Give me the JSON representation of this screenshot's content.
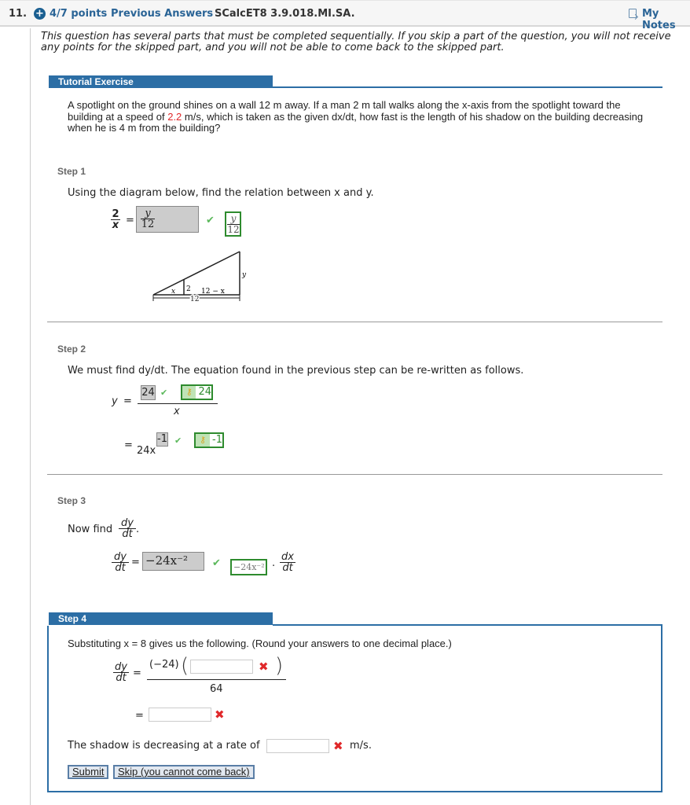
{
  "header": {
    "question_number": "11.",
    "points": "4/7 points",
    "previous_answers": "Previous Answers",
    "problem_code": "SCalcET8 3.9.018.MI.SA.",
    "my_notes": "My Notes"
  },
  "intro": "This question has several parts that must be completed sequentially. If you skip a part of the question, you will not receive any points for the skipped part, and you will not be able to come back to the skipped part.",
  "tutorial": {
    "band_label": "Tutorial Exercise",
    "problem_before_speed": "A spotlight on the ground shines on a wall 12 m away. If a man 2 m tall walks along the x-axis from the spotlight toward the building at a speed of ",
    "speed": "2.2",
    "problem_after_speed": " m/s, which is taken as the given dx/dt, how fast is the length of his shadow on the building decreasing when he is 4 m from the building?"
  },
  "step1": {
    "label": "Step 1",
    "instruction": "Using the diagram below, find the relation between x and y.",
    "lhs_num": "2",
    "lhs_den": "x",
    "equals": "=",
    "answer_num": "y",
    "answer_den": "12",
    "key_num": "y",
    "key_den": "12",
    "diagram": {
      "label_x": "x",
      "label_2": "2",
      "label_12_minus_x": "12 − x",
      "label_y": "y",
      "label_12": "12"
    }
  },
  "step2": {
    "label": "Step 2",
    "instruction": "We must find dy/dt. The equation found in the previous step can be re-written as follows.",
    "lhs": "y",
    "equals": "=",
    "answer1": "24",
    "key1": "24",
    "denominator": "x",
    "base": "24x",
    "answer2": "-1",
    "key2": "-1"
  },
  "step3": {
    "label": "Step 3",
    "prompt": "Now find",
    "dy": "dy",
    "dt": "dt",
    "answer": "−24x⁻²",
    "key": "−24x⁻²",
    "dx": "dx",
    "equals": "="
  },
  "step4": {
    "label": "Step 4",
    "instruction": "Substituting  x = 8  gives us the following. (Round your answers to one decimal place.)",
    "dy": "dy",
    "dt": "dt",
    "factor": "(−24)",
    "denominator": "64",
    "input1_value": "",
    "input2_value": "",
    "equals": "=",
    "rate_text": "The shadow is decreasing at a rate of",
    "rate_value": "",
    "units": "m/s.",
    "submit": "Submit",
    "skip": "Skip (you cannot come back)"
  }
}
